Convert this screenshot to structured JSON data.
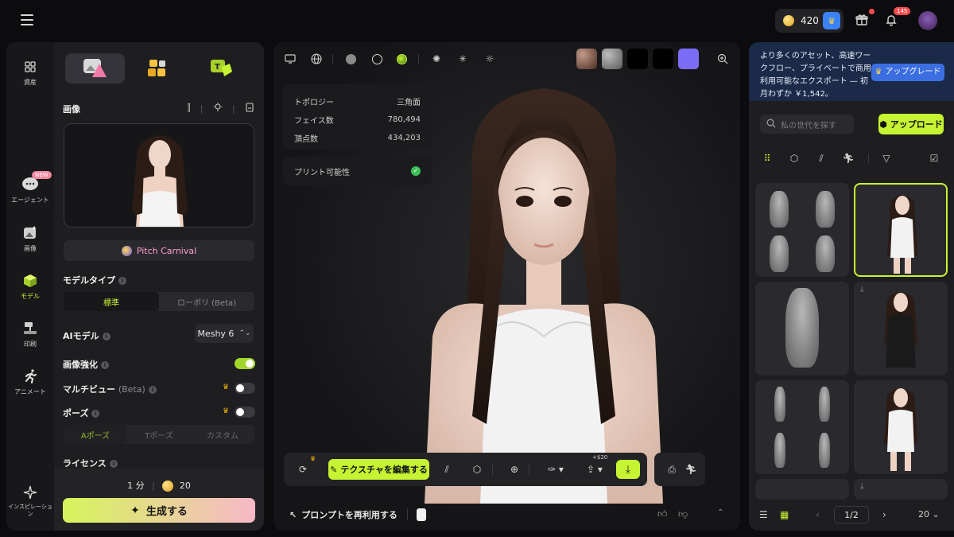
{
  "topbar": {
    "credits": "420",
    "notif_count": "145"
  },
  "leftnav": {
    "items": [
      {
        "label": "資産"
      },
      {
        "label": "エージェント",
        "badge": "NEW"
      },
      {
        "label": "画像"
      },
      {
        "label": "モデル"
      },
      {
        "label": "印刷"
      },
      {
        "label": "アニメート"
      },
      {
        "label": "インスピレーション"
      }
    ]
  },
  "panel": {
    "image_title": "画像",
    "pitch_label": "Pitch Carnival",
    "model_type_label": "モデルタイプ",
    "model_type_options": [
      "標準",
      "ローポリ (Beta)"
    ],
    "ai_model_label": "AIモデル",
    "ai_model_value": "Meshy 6",
    "enhance_label": "画像強化",
    "multiview_label": "マルチビュー",
    "multiview_sub": "(Beta)",
    "pose_label": "ポーズ",
    "pose_options": [
      "Aポーズ",
      "Tポーズ",
      "カスタム"
    ],
    "license_label": "ライセンス",
    "time": "1 分",
    "cost": "20",
    "generate_label": "生成する"
  },
  "viewport": {
    "stats": [
      {
        "k": "トポロジー",
        "v": "三角面"
      },
      {
        "k": "フェイス数",
        "v": "780,494"
      },
      {
        "k": "頂点数",
        "v": "434,203"
      }
    ],
    "printability": "プリント可能性",
    "edit_texture": "テクスチャを編集する",
    "export_cost": "+$20",
    "reuse_prompt": "プロンプトを再利用する",
    "swatch_colors": [
      "#7a5a4a",
      "#8a8a8a",
      "#000000",
      "#000000",
      "#7b6cf6"
    ]
  },
  "rpanel": {
    "promo_text": "より多くのアセット、高速ワークフロー、プライベートで商用利用可能なエクスポート — 初月わずか ￥1,542。",
    "upgrade_label": "アップグレード",
    "search_placeholder": "私の世代を探す",
    "upload_label": "アップロード",
    "page": "1/2",
    "page_size": "20"
  },
  "colors": {
    "accent": "#c6f432",
    "panel": "#1e1e21",
    "promo": "#1a2a48"
  }
}
